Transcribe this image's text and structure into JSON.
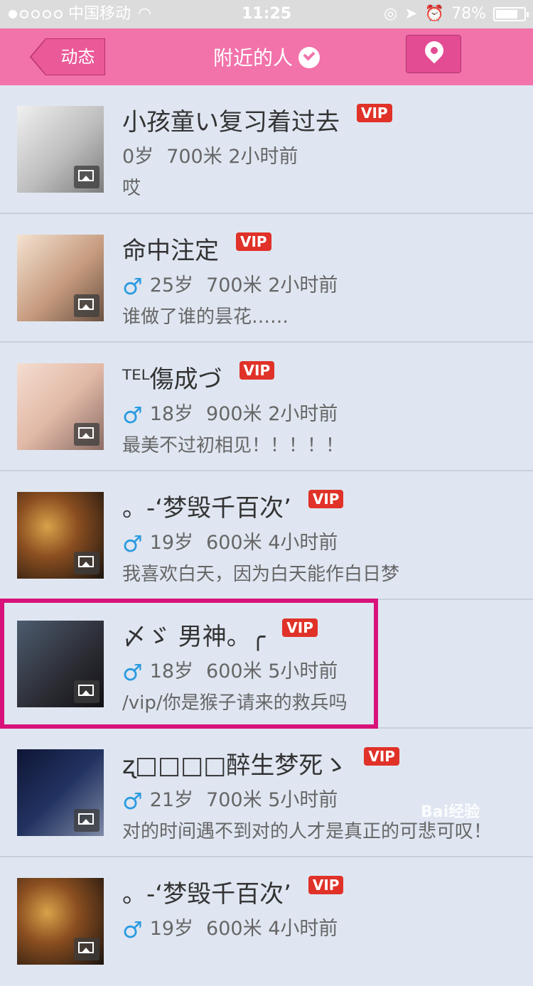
{
  "status_bar": {
    "carrier": "中国移动",
    "time": "11:25",
    "battery": "78%",
    "battery_level": 0.78
  },
  "nav": {
    "back_label": "动态",
    "title": "附近的人",
    "check_icon": "check-circle-icon",
    "location_icon": "location-pin-icon"
  },
  "users": [
    {
      "name": "小孩童い复习着过去",
      "vip": "VIP",
      "gender": "",
      "age": "0岁",
      "distance": "700米",
      "time": "2小时前",
      "status": "哎"
    },
    {
      "name": "命中注定",
      "vip": "VIP",
      "gender": "♂",
      "age": "25岁",
      "distance": "700米",
      "time": "2小时前",
      "status": "谁做了谁的昙花……"
    },
    {
      "name": "ᵀᴱᴸ傷成づ",
      "vip": "VIP",
      "gender": "♂",
      "age": "18岁",
      "distance": "900米",
      "time": "2小时前",
      "status": "最美不过初相见！！！！！"
    },
    {
      "name": "。-‘梦毁千百次’",
      "vip": "VIP",
      "gender": "♂",
      "age": "19岁",
      "distance": "600米",
      "time": "4小时前",
      "status": "我喜欢白天，因为白天能作白日梦"
    },
    {
      "name": "〆ゞ  男神。╭",
      "vip": "VIP",
      "gender": "♂",
      "age": "18岁",
      "distance": "600米",
      "time": "5小时前",
      "status": "/vip/你是猴子请来的救兵吗"
    },
    {
      "name": "ʐ□□□□醉生梦死ゝ",
      "vip": "VIP",
      "gender": "♂",
      "age": "21岁",
      "distance": "700米",
      "time": "5小时前",
      "status": "对的时间遇不到对的人才是真正的可悲可叹！"
    },
    {
      "name": "。-‘梦毁千百次’",
      "vip": "VIP",
      "gender": "♂",
      "age": "19岁",
      "distance": "600米",
      "time": "4小时前",
      "status": ""
    }
  ],
  "watermark": "Bai经验"
}
